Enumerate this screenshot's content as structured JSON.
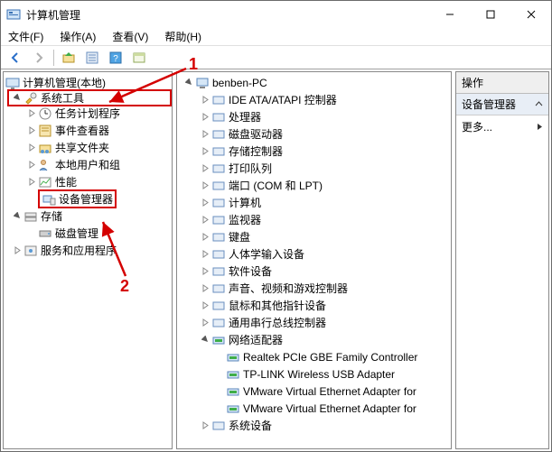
{
  "window": {
    "title": "计算机管理"
  },
  "menu": {
    "file": "文件(F)",
    "action": "操作(A)",
    "view": "查看(V)",
    "help": "帮助(H)"
  },
  "toolbar_icons": {
    "back": "back-icon",
    "forward": "forward-icon",
    "up": "up-folder-icon",
    "props": "properties-icon",
    "help": "help-icon",
    "last": "view-icon"
  },
  "annotation": {
    "one": "1",
    "two": "2"
  },
  "left_tree": {
    "root": "计算机管理(本地)",
    "system_tools": "系统工具",
    "task_scheduler": "任务计划程序",
    "event_viewer": "事件查看器",
    "shared_folders": "共享文件夹",
    "local_users": "本地用户和组",
    "performance": "性能",
    "device_manager": "设备管理器",
    "storage": "存储",
    "disk_mgmt": "磁盘管理",
    "services_apps": "服务和应用程序"
  },
  "mid_tree": {
    "root": "benben-PC",
    "items": [
      "IDE ATA/ATAPI 控制器",
      "处理器",
      "磁盘驱动器",
      "存储控制器",
      "打印队列",
      "端口 (COM 和 LPT)",
      "计算机",
      "监视器",
      "键盘",
      "人体学输入设备",
      "软件设备",
      "声音、视频和游戏控制器",
      "鼠标和其他指针设备",
      "通用串行总线控制器"
    ],
    "network": "网络适配器",
    "adapters": [
      "Realtek PCIe GBE Family Controller",
      "TP-LINK Wireless USB Adapter",
      "VMware Virtual Ethernet Adapter for",
      "VMware Virtual Ethernet Adapter for"
    ],
    "system_devices": "系统设备"
  },
  "right": {
    "header": "操作",
    "item": "设备管理器",
    "more": "更多..."
  }
}
